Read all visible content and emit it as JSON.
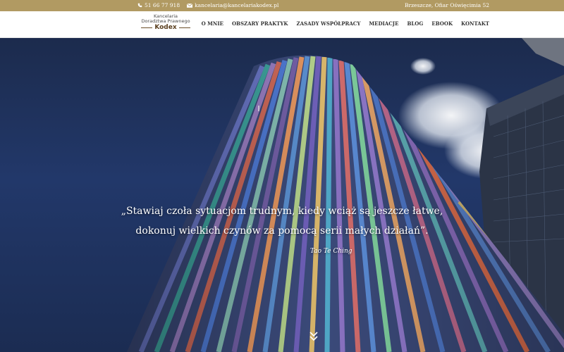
{
  "topbar": {
    "phone": "51 66 77 918",
    "email": "kancelaria@kancelariakodex.pl",
    "address": "Brzeszcze, Ofiar Oświęcimia 52",
    "phone_icon": "phone-icon",
    "email_icon": "envelope-icon"
  },
  "logo": {
    "line1": "Kancelaria",
    "line2": "Doradztwa Prawnego",
    "line3": "Kodex"
  },
  "nav": {
    "items": [
      "O MNIE",
      "OBSZARY PRAKTYK",
      "ZASADY WSPÓŁPRACY",
      "MEDIACJE",
      "BLOG",
      "EBOOK",
      "KONTAKT"
    ]
  },
  "hero": {
    "quote_line1": "„Stawiaj czoła sytuacjom trudnym, kiedy wciąż są jeszcze łatwe,",
    "quote_line2": "dokonuj wielkich czynów za pomocą serii małych działań”.",
    "author": "Tao Te Ching",
    "scroll_icon": "double-chevron-down-icon"
  },
  "colors": {
    "gold": "#b19a62",
    "sky": "#22386a",
    "text_dark": "#333333"
  }
}
